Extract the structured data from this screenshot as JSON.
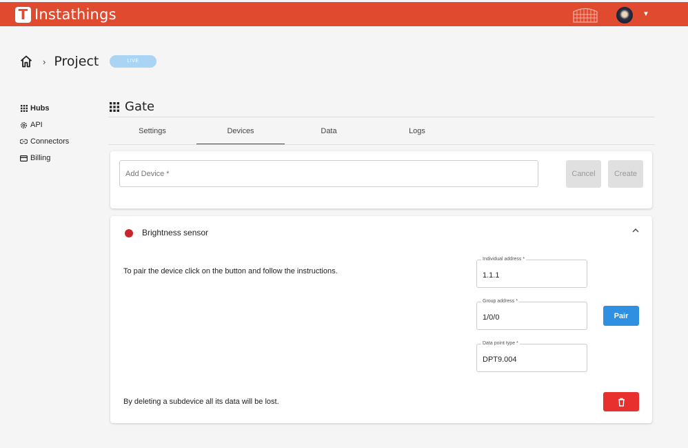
{
  "app": {
    "name": "Instathings",
    "logo_letter": "T",
    "brand_color": "#e04a2f"
  },
  "header": {
    "user_menu_icon": "chevron-down-icon"
  },
  "breadcrumb": {
    "home_icon": "home-icon",
    "separator": "›",
    "title": "Project",
    "badge": "LIVE"
  },
  "sidebar": {
    "items": [
      {
        "label": "Hubs",
        "icon": "grid-icon",
        "active": true
      },
      {
        "label": "API",
        "icon": "gear-icon",
        "active": false
      },
      {
        "label": "Connectors",
        "icon": "link-icon",
        "active": false
      },
      {
        "label": "Billing",
        "icon": "card-icon",
        "active": false
      }
    ]
  },
  "hub": {
    "title": "Gate",
    "icon": "grid-icon"
  },
  "tabs": [
    {
      "label": "Settings",
      "active": false
    },
    {
      "label": "Devices",
      "active": true
    },
    {
      "label": "Data",
      "active": false
    },
    {
      "label": "Logs",
      "active": false
    }
  ],
  "add_device": {
    "placeholder": "Add Device *",
    "cancel_label": "Cancel",
    "create_label": "Create"
  },
  "device": {
    "name": "Brightness sensor",
    "status_color": "#c8262b",
    "pair_instructions": "To pair the device click on the button and follow the instructions.",
    "fields": {
      "individual_address": {
        "label": "Individual address *",
        "value": "1.1.1"
      },
      "group_address": {
        "label": "Group address *",
        "value": "1/0/0"
      },
      "data_point_type": {
        "label": "Data point type *",
        "value": "DPT9.004"
      }
    },
    "pair_label": "Pair",
    "delete_warning": "By deleting a subdevice all its data will be lost.",
    "delete_icon": "trash-icon"
  }
}
